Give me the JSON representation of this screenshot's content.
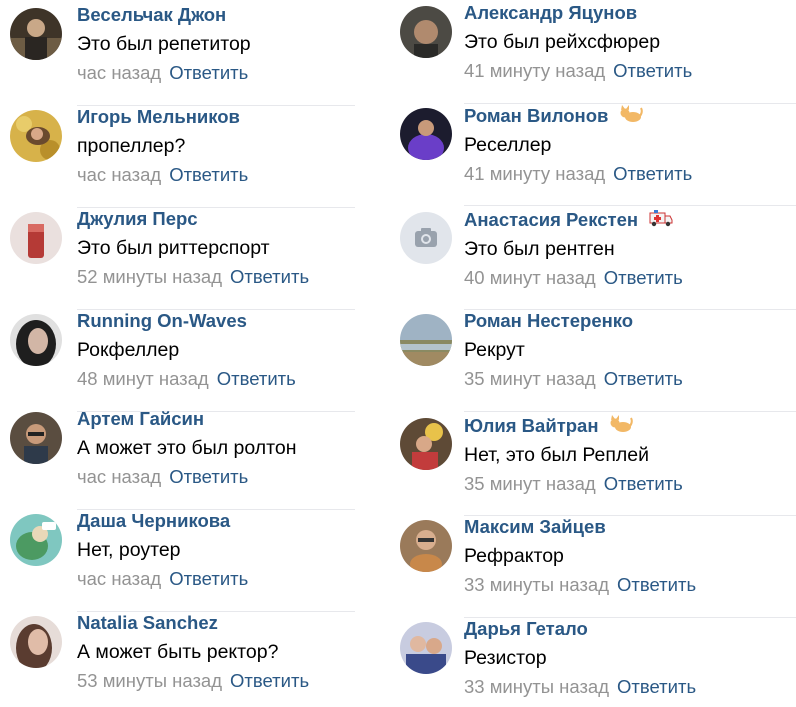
{
  "left_column": [
    {
      "author": "Весельчак Джон",
      "text": "Это был репетитор",
      "time": "час назад",
      "reply": "Ответить",
      "avatar": "avatar-photo",
      "color": "#5a4a3a"
    },
    {
      "author": "Игорь Мельников",
      "text": "пропеллер?",
      "time": "час назад",
      "reply": "Ответить",
      "avatar": "avatar-photo",
      "color": "#c8a23a"
    },
    {
      "author": "Джулия Перс",
      "text": "Это был риттерспорт",
      "time": "52 минуты назад",
      "reply": "Ответить",
      "avatar": "avatar-photo",
      "color": "#d9c6c4"
    },
    {
      "author": "Running On-Waves",
      "text": "Рокфеллер",
      "time": "48 минут назад",
      "reply": "Ответить",
      "avatar": "avatar-photo",
      "color": "#3a3a3a"
    },
    {
      "author": "Артем Гайсин",
      "text": "А может это был ролтон",
      "time": "час назад",
      "reply": "Ответить",
      "avatar": "avatar-photo",
      "color": "#6e5a48"
    },
    {
      "author": "Даша Черникова",
      "text": "Нет, роутер",
      "time": "час назад",
      "reply": "Ответить",
      "avatar": "avatar-photo",
      "color": "#4aa0a0"
    },
    {
      "author": "Natalia Sanchez",
      "text": "А может быть ректор?",
      "time": "53 минуты назад",
      "reply": "Ответить",
      "avatar": "avatar-photo",
      "color": "#b08a7a"
    }
  ],
  "right_column": [
    {
      "author": "Александр Яцунов",
      "text": "Это был рейхсфюрер",
      "time": "41 минуту назад",
      "reply": "Ответить",
      "avatar": "avatar-photo",
      "color": "#4a4a44"
    },
    {
      "author": "Роман Вилонов",
      "text": "Реселлер",
      "time": "41 минуту назад",
      "reply": "Ответить",
      "avatar": "avatar-photo",
      "color": "#2a2a6a",
      "badge": "cat-emoji-icon"
    },
    {
      "author": "Анастасия Рекстен",
      "text": "Это был рентген",
      "time": "40 минут назад",
      "reply": "Ответить",
      "avatar": "camera-placeholder-icon",
      "color": "#dfe3e8",
      "badge": "ambulance-emoji-icon"
    },
    {
      "author": "Роман Нестеренко",
      "text": "Рекрут",
      "time": "35 минут назад",
      "reply": "Ответить",
      "avatar": "avatar-photo",
      "color": "#8a9a8a"
    },
    {
      "author": "Юлия Вайтран",
      "text": "Нет, это был Реплей",
      "time": "35 минут назад",
      "reply": "Ответить",
      "avatar": "avatar-photo",
      "color": "#7a5a3a",
      "badge": "cat-emoji-icon"
    },
    {
      "author": "Максим Зайцев",
      "text": "Рефрактор",
      "time": "33 минуты назад",
      "reply": "Ответить",
      "avatar": "avatar-photo",
      "color": "#8a6a4a"
    },
    {
      "author": "Дарья Гетало",
      "text": "Резистор",
      "time": "33 минуты назад",
      "reply": "Ответить",
      "avatar": "avatar-photo",
      "color": "#5a6a9a"
    }
  ],
  "colors": {
    "link": "#2a5885",
    "meta": "#939393",
    "divider": "#e7e8ec"
  }
}
